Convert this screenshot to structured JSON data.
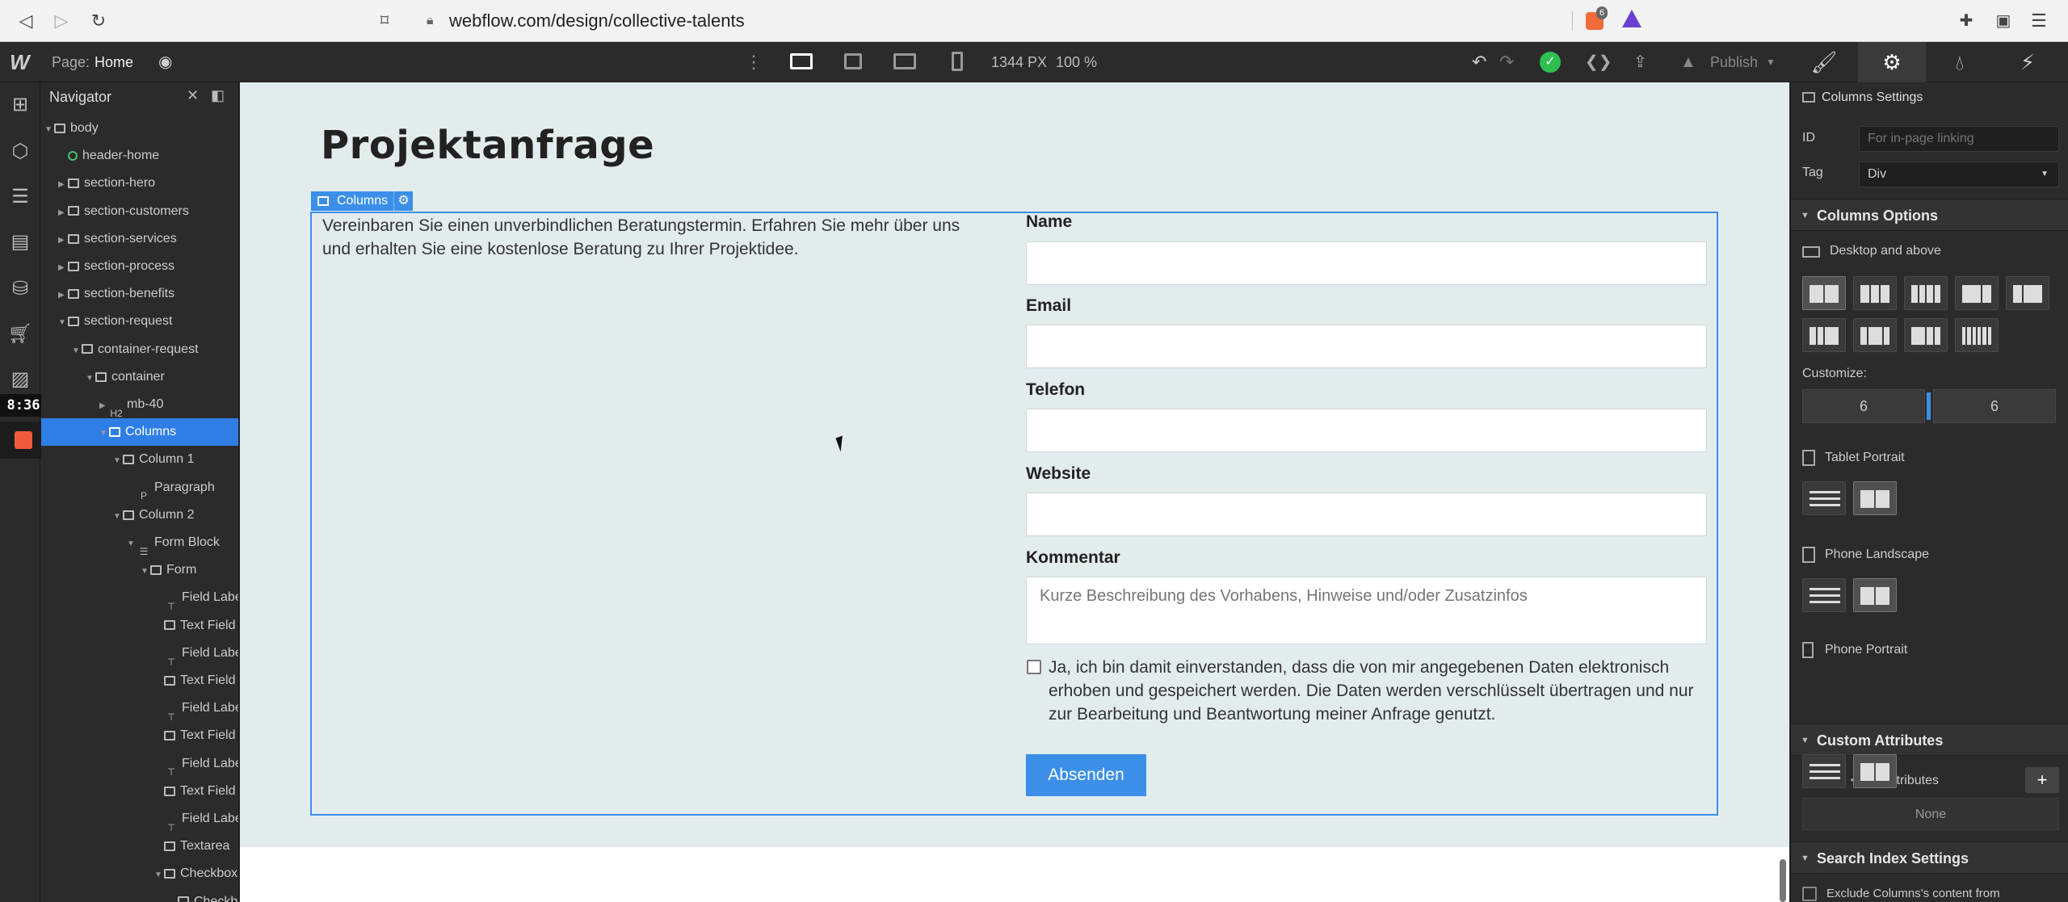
{
  "browser": {
    "url": "webflow.com/design/collective-talents",
    "brave_badge": "6"
  },
  "topbar": {
    "page_label": "Page:",
    "page_name": "Home",
    "canvas_width": "1344 PX",
    "zoom": "100 %",
    "publish_label": "Publish"
  },
  "sidebar_strip": {
    "timer": "8:36"
  },
  "navigator": {
    "title": "Navigator",
    "items": [
      {
        "label": "body",
        "depth": 0,
        "expanded": true,
        "icon": "box"
      },
      {
        "label": "header-home",
        "depth": 1,
        "icon": "component"
      },
      {
        "label": "section-hero",
        "depth": 1,
        "icon": "section",
        "collapsed": true
      },
      {
        "label": "section-customers",
        "depth": 1,
        "icon": "section",
        "collapsed": true
      },
      {
        "label": "section-services",
        "depth": 1,
        "icon": "section",
        "collapsed": true
      },
      {
        "label": "section-process",
        "depth": 1,
        "icon": "section",
        "collapsed": true
      },
      {
        "label": "section-benefits",
        "depth": 1,
        "icon": "section",
        "collapsed": true
      },
      {
        "label": "section-request",
        "depth": 1,
        "icon": "section",
        "expanded": true
      },
      {
        "label": "container-request",
        "depth": 2,
        "icon": "box",
        "expanded": true
      },
      {
        "label": "container",
        "depth": 3,
        "icon": "container",
        "expanded": true
      },
      {
        "label": "mb-40",
        "depth": 4,
        "icon": "H2",
        "collapsed": true
      },
      {
        "label": "Columns",
        "depth": 4,
        "icon": "columns",
        "expanded": true,
        "selected": true
      },
      {
        "label": "Column 1",
        "depth": 5,
        "icon": "column",
        "expanded": true
      },
      {
        "label": "Paragraph",
        "depth": 6,
        "icon": "P"
      },
      {
        "label": "Column 2",
        "depth": 5,
        "icon": "column",
        "expanded": true
      },
      {
        "label": "Form Block",
        "depth": 6,
        "icon": "form",
        "expanded": true
      },
      {
        "label": "Form",
        "depth": 7,
        "icon": "box",
        "expanded": true
      },
      {
        "label": "Field Labe",
        "depth": 8,
        "icon": "label"
      },
      {
        "label": "Text Field",
        "depth": 8,
        "icon": "box"
      },
      {
        "label": "Field Labe",
        "depth": 8,
        "icon": "label"
      },
      {
        "label": "Text Field",
        "depth": 8,
        "icon": "box"
      },
      {
        "label": "Field Labe",
        "depth": 8,
        "icon": "label"
      },
      {
        "label": "Text Field",
        "depth": 8,
        "icon": "box"
      },
      {
        "label": "Field Labe",
        "depth": 8,
        "icon": "label"
      },
      {
        "label": "Text Field",
        "depth": 8,
        "icon": "box"
      },
      {
        "label": "Field Labe",
        "depth": 8,
        "icon": "label"
      },
      {
        "label": "Textarea",
        "depth": 8,
        "icon": "box"
      },
      {
        "label": "Checkbox",
        "depth": 8,
        "icon": "box",
        "expanded": true
      },
      {
        "label": "Checkb",
        "depth": 9,
        "icon": "check"
      }
    ]
  },
  "canvas": {
    "heading": "Projektanfrage",
    "element_badge": "Columns",
    "intro": "Vereinbaren Sie einen unverbindlichen Beratungstermin. Erfahren Sie mehr über uns und erhalten Sie eine kostenlose Beratung zu Ihrer Projektidee.",
    "fields": [
      {
        "label": "Name",
        "placeholder": ""
      },
      {
        "label": "Email",
        "placeholder": ""
      },
      {
        "label": "Telefon",
        "placeholder": ""
      },
      {
        "label": "Website",
        "placeholder": ""
      }
    ],
    "comment_label": "Kommentar",
    "comment_placeholder": "Kurze Beschreibung des Vorhabens, Hinweise und/oder Zusatzinfos",
    "consent": "Ja, ich bin damit einverstanden, dass die von mir angegebenen Daten elektronisch erhoben und gespeichert werden. Die Daten werden verschlüsselt übertragen und nur zur Bearbeitung und Beantwortung meiner Anfrage genutzt.",
    "submit": "Absenden"
  },
  "panel": {
    "element_title": "Columns Settings",
    "id_label": "ID",
    "id_placeholder": "For in-page linking",
    "tag_label": "Tag",
    "tag_value": "Div",
    "columns_options": "Columns Options",
    "desktop": "Desktop and above",
    "customize": "Customize:",
    "customize_values": [
      "6",
      "6"
    ],
    "tablet": "Tablet Portrait",
    "phone_landscape": "Phone Landscape",
    "phone_portrait": "Phone Portrait",
    "custom_attributes": "Custom Attributes",
    "custom_div_attr": "Custom <div> attributes",
    "none": "None",
    "search_index": "Search Index Settings",
    "exclude": "Exclude Columns's content from"
  },
  "colors": {
    "accent": "#3b8fe8",
    "canvas_bg": "#e3eced",
    "ui_bg": "#2b2b2b",
    "success": "#2fbf4f"
  }
}
